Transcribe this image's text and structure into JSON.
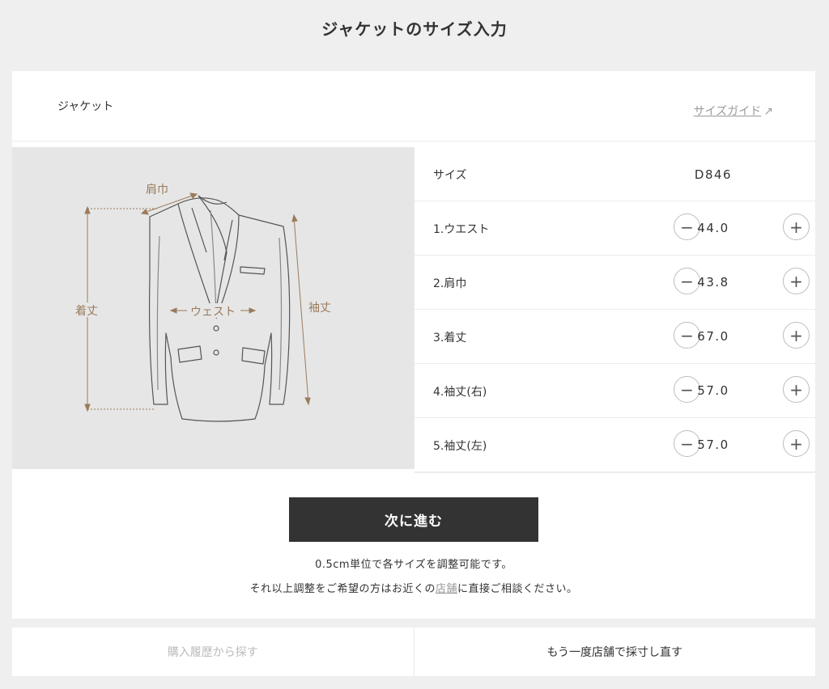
{
  "page": {
    "title": "ジャケットのサイズ入力"
  },
  "product": {
    "label": "ジャケット",
    "size_guide_label": "サイズガイド",
    "size_guide_arrow": "↗"
  },
  "illustration": {
    "shoulder_label": "肩巾",
    "length_label": "着丈",
    "waist_label": "ウェスト",
    "sleeve_label": "袖丈"
  },
  "size_row": {
    "label": "サイズ",
    "value": "D846"
  },
  "measurements": [
    {
      "label": "1.ウエスト",
      "value": "44.0"
    },
    {
      "label": "2.肩巾",
      "value": "43.8"
    },
    {
      "label": "3.着丈",
      "value": "67.0"
    },
    {
      "label": "4.袖丈(右)",
      "value": "57.0"
    },
    {
      "label": "5.袖丈(左)",
      "value": "57.0"
    }
  ],
  "stepper": {
    "minus": "−",
    "plus": "+"
  },
  "next_button": "次に進む",
  "notes": {
    "line1": "0.5cm単位で各サイズを調整可能です。",
    "line2_before": "それ以上調整をご希望の方はお近くの",
    "line2_link": "店舗",
    "line2_after": "に直接ご相談ください。"
  },
  "footer": {
    "history_button": "購入履歴から探す",
    "rescan_button": "もう一度店舗で採寸し直す"
  },
  "colors": {
    "background": "#efefef",
    "primary_button": "#333333",
    "annotation": "#9a7b5b",
    "muted_link": "#999999"
  }
}
